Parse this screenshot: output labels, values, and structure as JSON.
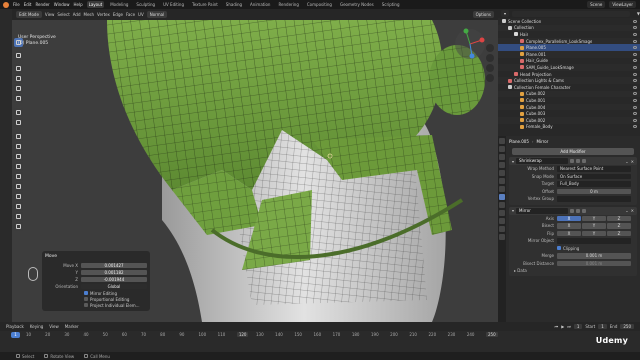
{
  "topbar": {
    "menus": [
      "File",
      "Edit",
      "Render",
      "Window",
      "Help"
    ],
    "workspaces": [
      "Layout",
      "Modeling",
      "Sculpting",
      "UV Editing",
      "Texture Paint",
      "Shading",
      "Animation",
      "Rendering",
      "Compositing",
      "Geometry Nodes",
      "Scripting"
    ],
    "active_workspace": "Layout",
    "scene": "Scene",
    "view_layer": "ViewLayer"
  },
  "viewport_header": {
    "mode": "Edit Mode",
    "menus": [
      "View",
      "Select",
      "Add",
      "Mesh",
      "Vertex",
      "Edge",
      "Face",
      "UV"
    ],
    "orientation": "Normal",
    "options": "Options"
  },
  "viewport": {
    "perspective": "User Perspective",
    "object": "(0) Plane.005"
  },
  "operator_panel": {
    "title": "Move",
    "move_x": "0.001427",
    "move_y": "0.001182",
    "move_z": "-0.001944",
    "orientation_label": "Orientation",
    "orientation_value": "Global",
    "mirror_editing": "Mirror Editing",
    "proportional_editing": "Proportional Editing",
    "project_individual": "Project Individual Elem..."
  },
  "outliner": {
    "search_placeholder": "",
    "rows": [
      {
        "label": "Scene Collection",
        "color": "#cccccc"
      },
      {
        "label": "Collection",
        "color": "#cccccc"
      },
      {
        "label": "Hair",
        "color": "#d9d9d9"
      },
      {
        "label": "Complex_Parallelism_LookSmage",
        "color": "#d96a6a"
      },
      {
        "label": "Plane.005",
        "color": "#e0a040"
      },
      {
        "label": "Plane.001",
        "color": "#e0a040"
      },
      {
        "label": "Hair_Guide",
        "color": "#d96a6a"
      },
      {
        "label": "SAM_Guide_LookSmage",
        "color": "#d96a6a"
      },
      {
        "label": "Head Projection",
        "color": "#d96a6a"
      },
      {
        "label": "Collection Lights & Cams",
        "color": "#d96a6a"
      },
      {
        "label": "Collection Female Character",
        "color": "#cccccc"
      },
      {
        "label": "Cube.002",
        "color": "#e0a040"
      },
      {
        "label": "Cube.001",
        "color": "#e0a040"
      },
      {
        "label": "Cube.004",
        "color": "#e0a040"
      },
      {
        "label": "Cube.003",
        "color": "#e0a040"
      },
      {
        "label": "Cube.002",
        "color": "#e0a040"
      },
      {
        "label": "Female_Body",
        "color": "#e0a040"
      }
    ],
    "selected_index": 4
  },
  "properties": {
    "object_name": "Plane.005",
    "modifier_name": "Mirror",
    "add_modifier": "Add Modifier",
    "shrinkwrap": {
      "name": "Shrinkwrap",
      "wrap_method_label": "Wrap Method",
      "wrap_method": "Nearest Surface Point",
      "snap_mode_label": "Snap Mode",
      "snap_mode": "On Surface",
      "target_label": "Target",
      "target": "Full_Body",
      "offset_label": "Offset",
      "offset": "0 m",
      "vertex_group_label": "Vertex Group",
      "vertex_group": ""
    },
    "mirror": {
      "name": "Mirror",
      "axis_label": "Axis",
      "bisect_label": "Bisect",
      "flip_label": "Flip",
      "axes": [
        "X",
        "Y",
        "Z"
      ],
      "mirror_object_label": "Mirror Object",
      "mirror_object": "",
      "clipping": "Clipping",
      "merge_label": "Merge",
      "merge": "0.001 m",
      "bisect_distance_label": "Bisect Distance",
      "bisect_distance": "0.001 m",
      "data": "Data"
    }
  },
  "timeline": {
    "menus": [
      "Playback",
      "Keying",
      "View",
      "Marker"
    ],
    "current_frame": "1",
    "start_label": "Start",
    "start": "1",
    "end_label": "End",
    "end": "250",
    "ticks": [
      "10",
      "20",
      "30",
      "40",
      "50",
      "60",
      "70",
      "80",
      "90",
      "100",
      "110",
      "120",
      "130",
      "140",
      "150",
      "160",
      "170",
      "180",
      "190",
      "200",
      "210",
      "220",
      "230",
      "240",
      "250"
    ],
    "highlighted_ticks": [
      "1",
      "120",
      "250"
    ]
  },
  "status": {
    "items": [
      "Select",
      "Rotate View",
      "Call Menu"
    ]
  },
  "watermark": "Udemy",
  "colors": {
    "mesh_green": "#6a9a3c",
    "selection_blue": "#4c7fd1",
    "accent_orange": "#e6813a"
  }
}
